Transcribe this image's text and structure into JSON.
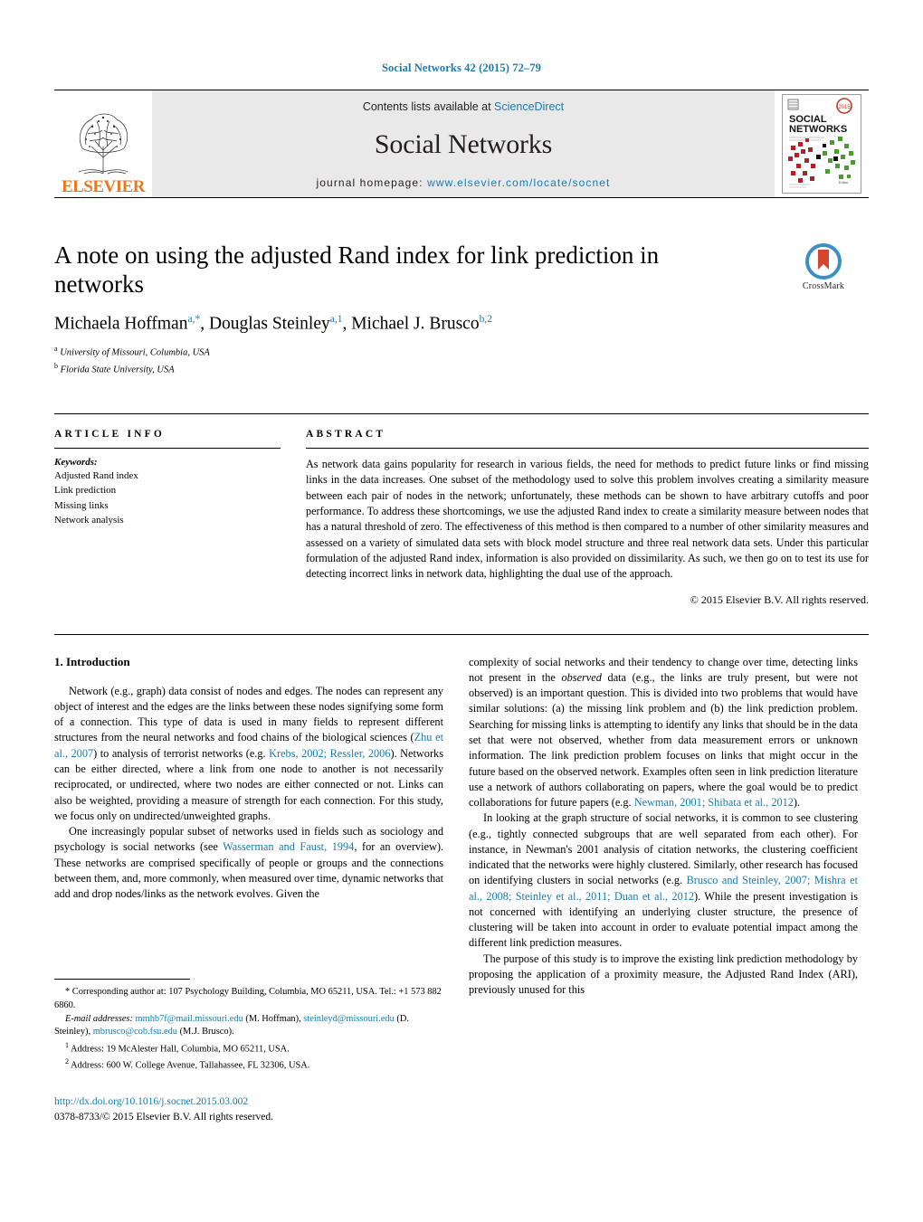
{
  "running_head": "Social Networks 42 (2015) 72–79",
  "masthead": {
    "publisher": "ELSEVIER",
    "contents_prefix": "Contents lists available at ",
    "contents_link": "ScienceDirect",
    "journal_name": "Social Networks",
    "homepage_prefix": "journal homepage: ",
    "homepage_url": "www.elsevier.com/locate/socnet",
    "cover_title_line1": "SOCIAL",
    "cover_title_line2": "NETWORKS",
    "cover_subtitle": "An international journal of structural analysis",
    "cover_badge": "2015"
  },
  "article": {
    "title": "A note on using the adjusted Rand index for link prediction in networks",
    "authors": [
      {
        "name": "Michaela Hoffman",
        "marks": "a,*"
      },
      {
        "name": "Douglas Steinley",
        "marks": "a,1"
      },
      {
        "name": "Michael J. Brusco",
        "marks": "b,2"
      }
    ],
    "authors_plain": "Michaela Hoffman, Douglas Steinley, Michael J. Brusco",
    "affiliations": [
      {
        "mark": "a",
        "text": "University of Missouri, Columbia, USA"
      },
      {
        "mark": "b",
        "text": "Florida State University, USA"
      }
    ],
    "crossmark_label": "CrossMark"
  },
  "article_info": {
    "heading": "ARTICLE INFO",
    "keywords_heading": "Keywords:",
    "keywords": [
      "Adjusted Rand index",
      "Link prediction",
      "Missing links",
      "Network analysis"
    ]
  },
  "abstract": {
    "heading": "ABSTRACT",
    "text": "As network data gains popularity for research in various fields, the need for methods to predict future links or find missing links in the data increases. One subset of the methodology used to solve this problem involves creating a similarity measure between each pair of nodes in the network; unfortunately, these methods can be shown to have arbitrary cutoffs and poor performance. To address these shortcomings, we use the adjusted Rand index to create a similarity measure between nodes that has a natural threshold of zero. The effectiveness of this method is then compared to a number of other similarity measures and assessed on a variety of simulated data sets with block model structure and three real network data sets. Under this particular formulation of the adjusted Rand index, information is also provided on dissimilarity. As such, we then go on to test its use for detecting incorrect links in network data, highlighting the dual use of the approach.",
    "copyright": "© 2015 Elsevier B.V. All rights reserved."
  },
  "body": {
    "section_number_title": "1.  Introduction",
    "left_paragraphs": [
      "Network (e.g., graph) data consist of nodes and edges. The nodes can represent any object of interest and the edges are the links between these nodes signifying some form of a connection. This type of data is used in many fields to represent different structures from the neural networks and food chains of the biological sciences (Zhu et al., 2007) to analysis of terrorist networks (e.g. Krebs, 2002; Ressler, 2006). Networks can be either directed, where a link from one node to another is not necessarily reciprocated, or undirected, where two nodes are either connected or not. Links can also be weighted, providing a measure of strength for each connection. For this study, we focus only on undirected/unweighted graphs.",
      "One increasingly popular subset of networks used in fields such as sociology and psychology is social networks (see Wasserman and Faust, 1994, for an overview). These networks are comprised specifically of people or groups and the connections between them, and, more commonly, when measured over time, dynamic networks that add and drop nodes/links as the network evolves. Given the"
    ],
    "right_paragraphs": [
      "complexity of social networks and their tendency to change over time, detecting links not present in the observed data (e.g., the links are truly present, but were not observed) is an important question. This is divided into two problems that would have similar solutions: (a) the missing link problem and (b) the link prediction problem. Searching for missing links is attempting to identify any links that should be in the data set that were not observed, whether from data measurement errors or unknown information. The link prediction problem focuses on links that might occur in the future based on the observed network. Examples often seen in link prediction literature use a network of authors collaborating on papers, where the goal would be to predict collaborations for future papers (e.g. Newman, 2001; Shibata et al., 2012).",
      "In looking at the graph structure of social networks, it is common to see clustering (e.g., tightly connected subgroups that are well separated from each other). For instance, in Newman's 2001 analysis of citation networks, the clustering coefficient indicated that the networks were highly clustered. Similarly, other research has focused on identifying clusters in social networks (e.g. Brusco and Steinley, 2007; Mishra et al., 2008; Steinley et al., 2011; Duan et al., 2012). While the present investigation is not concerned with identifying an underlying cluster structure, the presence of clustering will be taken into account in order to evaluate potential impact among the different link prediction measures.",
      "The purpose of this study is to improve the existing link prediction methodology by proposing the application of a proximity measure, the Adjusted Rand Index (ARI), previously unused for this"
    ],
    "citations_left": [
      "Zhu et al., 2007",
      "Krebs, 2002; Ressler, 2006",
      "Wasserman and Faust, 1994"
    ],
    "citations_right": [
      "Newman, 2001; Shibata et al., 2012",
      "Brusco and Steinley, 2007; Mishra et al., 2008; Steinley et al., 2011; Duan et al., 2012"
    ]
  },
  "footnotes": {
    "corresponding": "* Corresponding author at: 107 Psychology Building, Columbia, MO 65211, USA. Tel.: +1 573 882 6860.",
    "email_label": "E-mail addresses:",
    "emails": [
      {
        "address": "mmhb7f@mail.missouri.edu",
        "owner": "(M. Hoffman)"
      },
      {
        "address": "steinleyd@missouri.edu",
        "owner": "(D. Steinley)"
      },
      {
        "address": "mbrusco@cob.fsu.edu",
        "owner": "(M.J. Brusco)"
      }
    ],
    "numbered": [
      {
        "mark": "1",
        "text": "Address: 19 McAlester Hall, Columbia, MO 65211, USA."
      },
      {
        "mark": "2",
        "text": "Address: 600 W. College Avenue, Tallahassee, FL 32306, USA."
      }
    ],
    "doi": "http://dx.doi.org/10.1016/j.socnet.2015.03.002",
    "issn_line": "0378-8733/© 2015 Elsevier B.V. All rights reserved."
  },
  "colors": {
    "link_blue": "#1a7bb0",
    "elsevier_orange": "#e87722",
    "crossmark_blue": "#3c8fc4",
    "crossmark_red": "#d8452e"
  }
}
